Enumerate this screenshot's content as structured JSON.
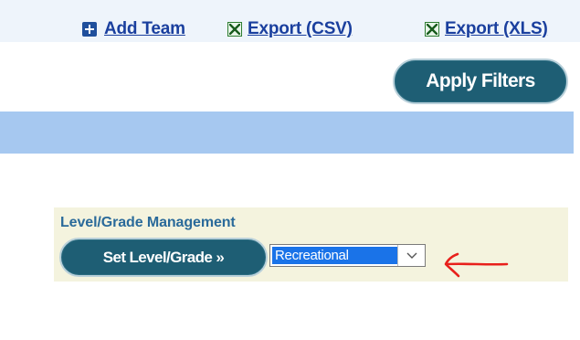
{
  "toolbar": {
    "add_team": "Add Team",
    "export_csv": "Export (CSV)",
    "export_xls": "Export (XLS)"
  },
  "filters": {
    "apply_label": "Apply Filters"
  },
  "level_grade": {
    "title": "Level/Grade Management",
    "set_button": "Set Level/Grade »",
    "selected": "Recreational"
  },
  "icons": {
    "add": "plus-box-icon",
    "export": "excel-file-icon",
    "dropdown": "chevron-down-icon",
    "annotation": "red-arrow-annotation"
  },
  "colors": {
    "link": "#1a3f9e",
    "button": "#1e5e74",
    "band": "#a6c8f0",
    "panel": "#f4f3de",
    "selection": "#1a73e8",
    "annotation": "#e8201c"
  }
}
